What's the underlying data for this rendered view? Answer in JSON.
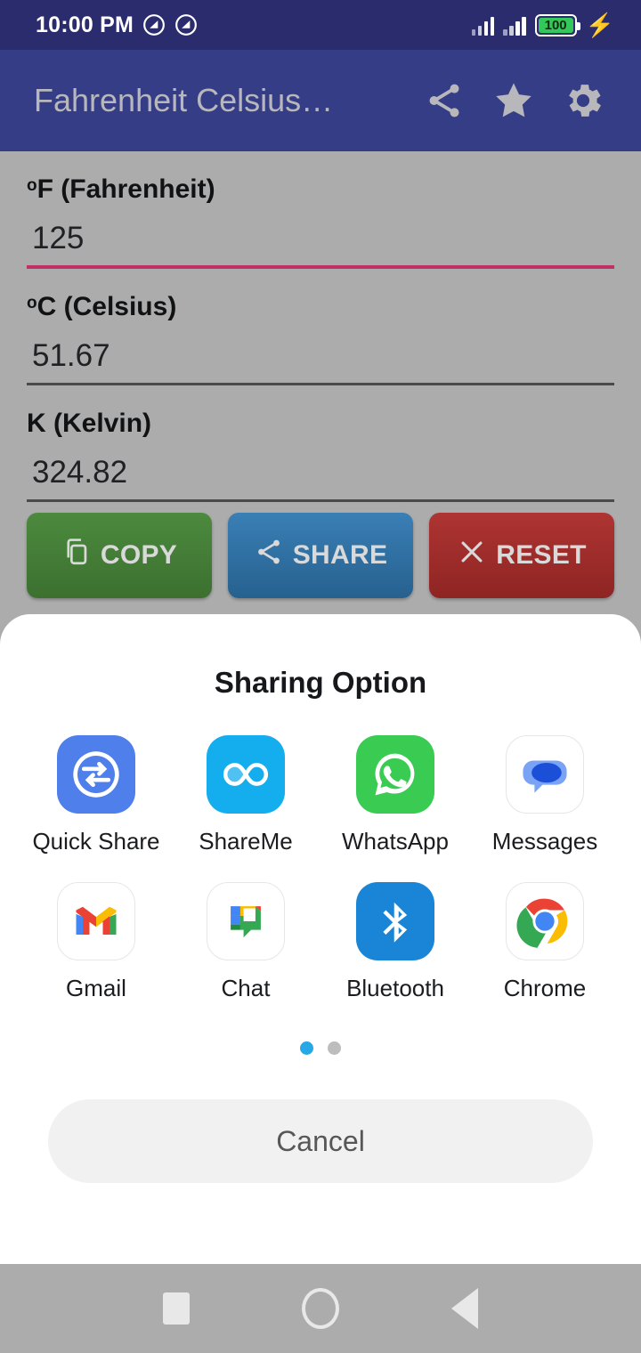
{
  "status_bar": {
    "clock": "10:00 PM",
    "notification_icons": [
      "do-not-disturb-icon",
      "do-not-disturb-icon"
    ],
    "signal_1": "signal-bars-icon",
    "signal_2": "signal-bars-icon",
    "battery_percent": "100",
    "charging": "charging-bolt-icon",
    "background_color": "#2B2C6E"
  },
  "app_bar": {
    "title": "Fahrenheit Celsius…",
    "background_color": "#353D86",
    "title_color": "#B7B7BC",
    "actions": [
      {
        "name": "share-icon",
        "label": "Share"
      },
      {
        "name": "star-icon",
        "label": "Favorite"
      },
      {
        "name": "gear-icon",
        "label": "Settings"
      }
    ]
  },
  "converter": {
    "background_color": "#ACACAC",
    "accent_color": "#BF3164",
    "fields": [
      {
        "unit_symbol": "o",
        "label": "F (Fahrenheit)",
        "value": "125",
        "focused": true
      },
      {
        "unit_symbol": "o",
        "label": "C (Celsius)",
        "value": "51.67",
        "focused": false
      },
      {
        "unit_symbol": "",
        "label": "K (Kelvin)",
        "value": "324.82",
        "focused": false
      }
    ],
    "buttons": [
      {
        "id": "copy",
        "label": "COPY",
        "icon": "copy-icon",
        "color": "#4C8A3E"
      },
      {
        "id": "share",
        "label": "SHARE",
        "icon": "share-icon",
        "color": "#3A7FB5"
      },
      {
        "id": "reset",
        "label": "RESET",
        "icon": "close-x-icon",
        "color": "#AE3432"
      }
    ]
  },
  "share_sheet": {
    "title": "Sharing Option",
    "apps": [
      {
        "name": "Quick Share",
        "icon": "quick-share-icon"
      },
      {
        "name": "ShareMe",
        "icon": "shareme-icon"
      },
      {
        "name": "WhatsApp",
        "icon": "whatsapp-icon"
      },
      {
        "name": "Messages",
        "icon": "google-messages-icon"
      },
      {
        "name": "Gmail",
        "icon": "gmail-icon"
      },
      {
        "name": "Chat",
        "icon": "google-chat-icon"
      },
      {
        "name": "Bluetooth",
        "icon": "bluetooth-icon"
      },
      {
        "name": "Chrome",
        "icon": "chrome-icon"
      }
    ],
    "pager": {
      "pages": 2,
      "active_index": 0,
      "active_color": "#29A8E8",
      "inactive_color": "#BDBDBD"
    },
    "cancel_label": "Cancel"
  },
  "nav_bar": {
    "background_color": "#ACACAC",
    "buttons": [
      {
        "name": "recents-button",
        "icon": "square-icon"
      },
      {
        "name": "home-button",
        "icon": "circle-icon"
      },
      {
        "name": "back-button",
        "icon": "triangle-left-icon"
      }
    ]
  }
}
